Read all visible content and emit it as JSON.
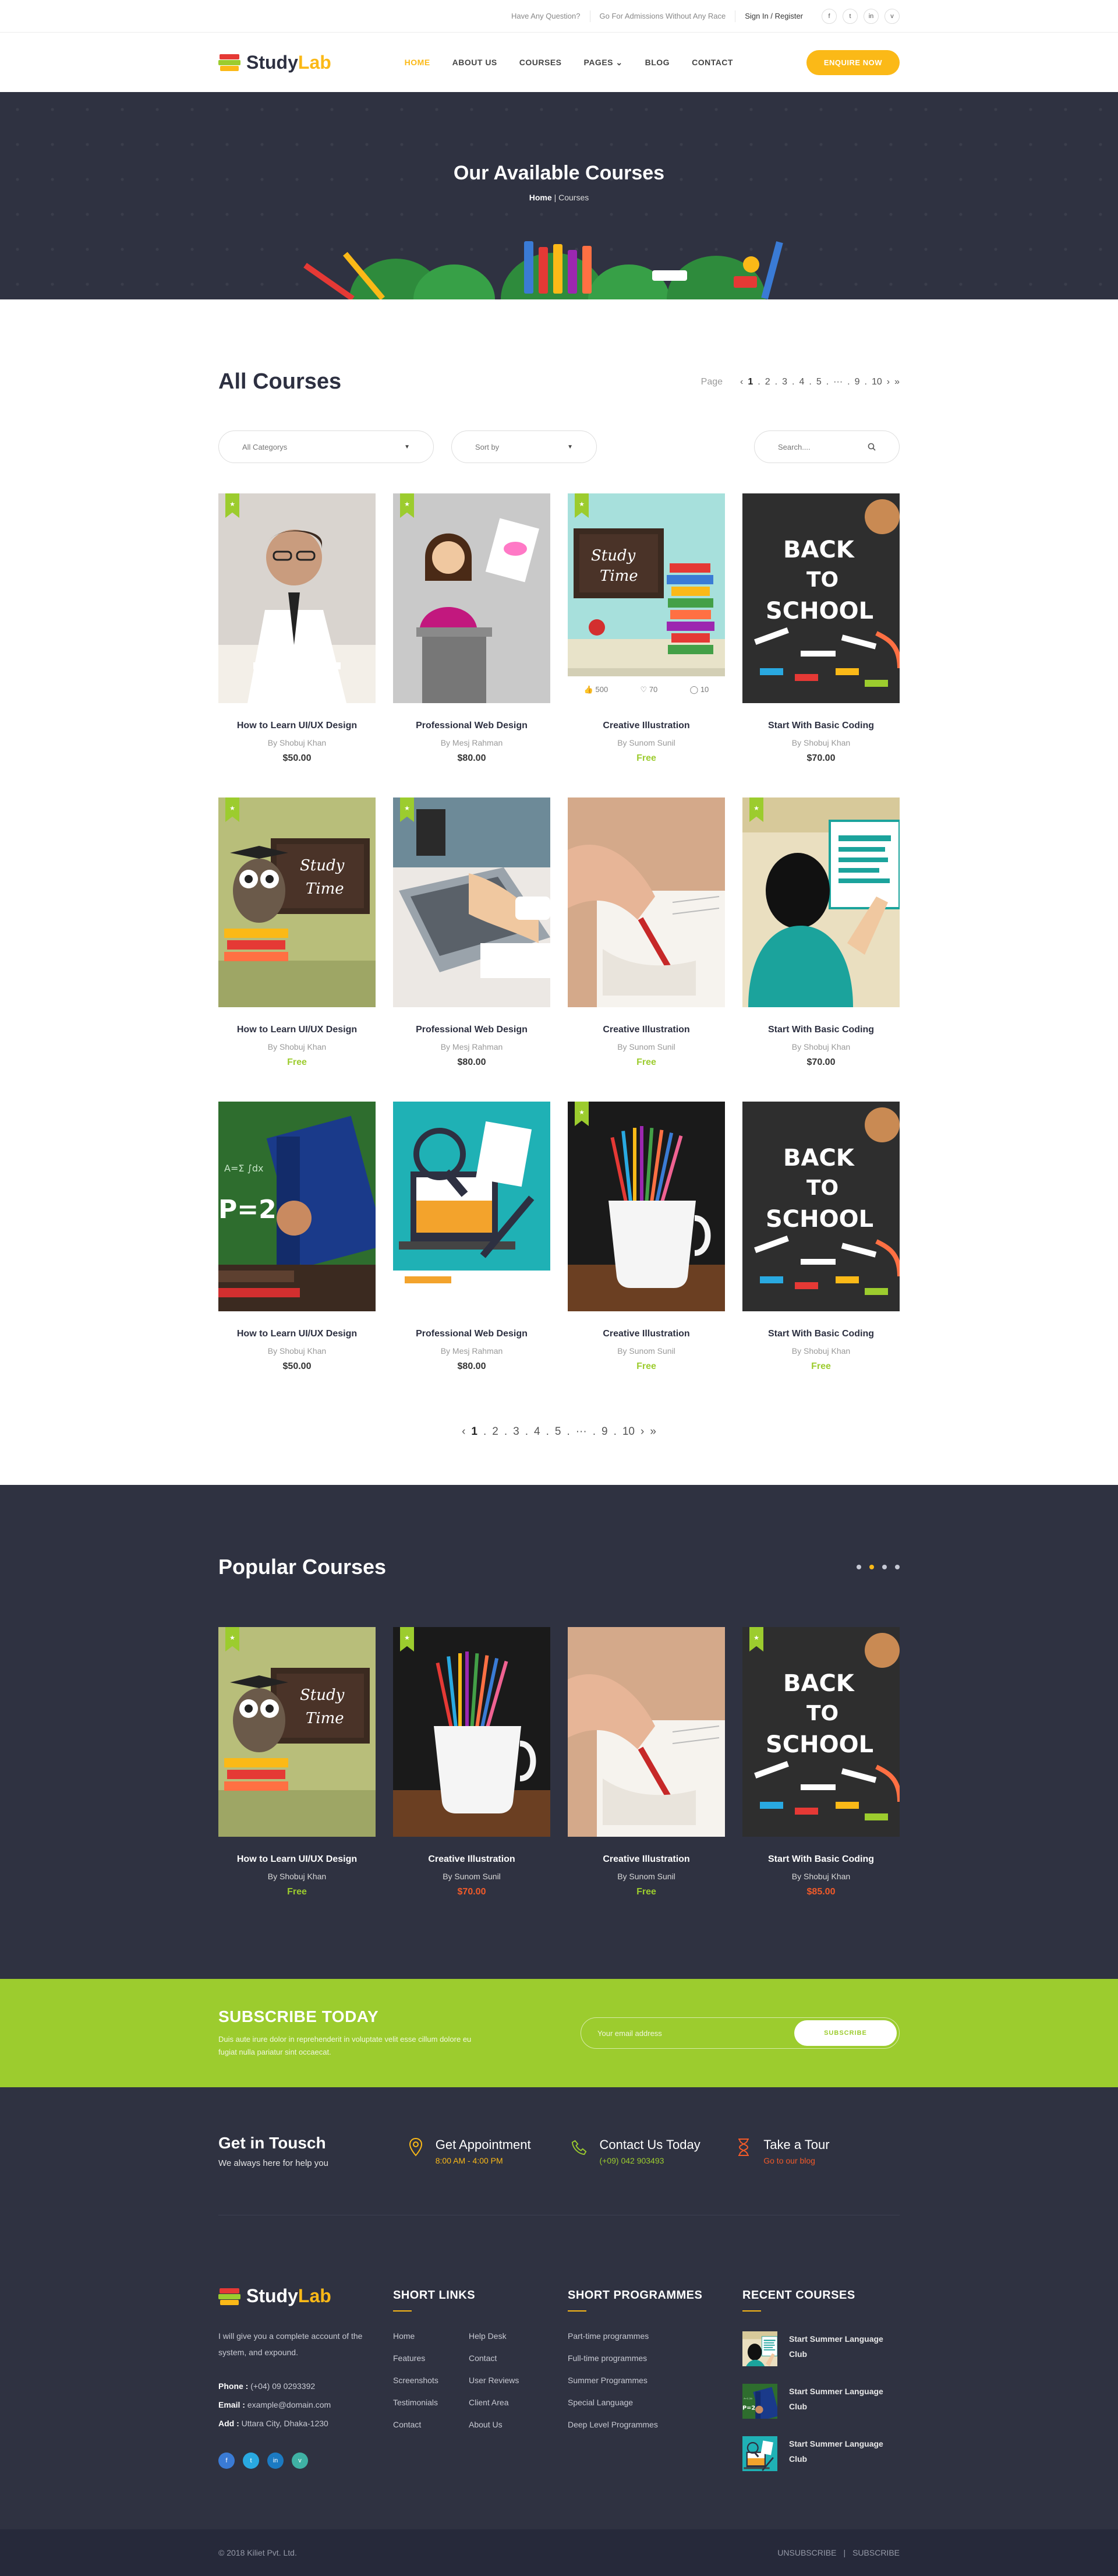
{
  "topbar": {
    "question": "Have Any Question?",
    "admissions": "Go For Admissions Without Any Race",
    "signin": "Sign In / Register",
    "socials": [
      "f",
      "t",
      "in",
      "v"
    ]
  },
  "header": {
    "logo_study": "Study",
    "logo_lab": "Lab",
    "nav": [
      "HOME",
      "ABOUT US",
      "COURSES",
      "PAGES",
      "BLOG",
      "CONTACT"
    ],
    "pages_caret": "⌄",
    "enquire": "ENQUIRE NOW",
    "accent": "#fbb917"
  },
  "hero": {
    "title": "Our Available Courses",
    "crumb_home": "Home",
    "crumb_sep": "|",
    "crumb_current": "Courses"
  },
  "all_courses": {
    "title": "All Courses",
    "page_label": "Page",
    "pager": [
      "‹",
      "1",
      ".",
      "2",
      ".",
      "3",
      ".",
      "4",
      ".",
      "5",
      ".",
      "···",
      ".",
      "9",
      ".",
      "10",
      "›",
      "»"
    ],
    "category_select": "All Categorys",
    "sort_select": "Sort by",
    "search_placeholder": "Search....",
    "courses": [
      {
        "title": "How to Learn UI/UX Design",
        "author": "By Shobuj Khan",
        "price": "$50.00",
        "free": false,
        "ribbon": true
      },
      {
        "title": "Professional Web Design",
        "author": "By Mesj Rahman",
        "price": "$80.00",
        "free": false,
        "ribbon": true
      },
      {
        "title": "Creative Illustration",
        "author": "By Sunom Sunil",
        "price": "Free",
        "free": true,
        "ribbon": true,
        "stats": [
          "500",
          "70",
          "10"
        ]
      },
      {
        "title": "Start With Basic Coding",
        "author": "By Shobuj Khan",
        "price": "$70.00",
        "free": false,
        "ribbon": false
      },
      {
        "title": "How to Learn UI/UX Design",
        "author": "By Shobuj Khan",
        "price": "Free",
        "free": true,
        "ribbon": true
      },
      {
        "title": "Professional Web Design",
        "author": "By Mesj Rahman",
        "price": "$80.00",
        "free": false,
        "ribbon": true
      },
      {
        "title": "Creative Illustration",
        "author": "By Sunom Sunil",
        "price": "Free",
        "free": true,
        "ribbon": false
      },
      {
        "title": "Start With Basic Coding",
        "author": "By Shobuj Khan",
        "price": "$70.00",
        "free": false,
        "ribbon": true
      },
      {
        "title": "How to Learn UI/UX Design",
        "author": "By Shobuj Khan",
        "price": "$50.00",
        "free": false,
        "ribbon": false
      },
      {
        "title": "Professional Web Design",
        "author": "By Mesj Rahman",
        "price": "$80.00",
        "free": false,
        "ribbon": false
      },
      {
        "title": "Creative Illustration",
        "author": "By Sunom Sunil",
        "price": "Free",
        "free": true,
        "ribbon": true
      },
      {
        "title": "Start With Basic Coding",
        "author": "By Shobuj Khan",
        "price": "Free",
        "free": true,
        "ribbon": false
      }
    ],
    "pager_bottom": [
      "‹",
      "1",
      ".",
      "2",
      ".",
      "3",
      ".",
      "4",
      ".",
      "5",
      ".",
      "···",
      ".",
      "9",
      ".",
      "10",
      "›",
      "»"
    ]
  },
  "popular": {
    "title": "Popular Courses",
    "courses": [
      {
        "title": "How to Learn UI/UX Design",
        "author": "By Shobuj Khan",
        "price": "Free",
        "style": "free"
      },
      {
        "title": "Creative Illustration",
        "author": "By Sunom Sunil",
        "price": "$70.00",
        "style": "red"
      },
      {
        "title": "Creative Illustration",
        "author": "By Sunom Sunil",
        "price": "Free",
        "style": "free"
      },
      {
        "title": "Start With Basic Coding",
        "author": "By Shobuj Khan",
        "price": "$85.00",
        "style": "red"
      }
    ]
  },
  "subscribe": {
    "title": "SUBSCRIBE TODAY",
    "text": "Duis aute irure dolor in reprehenderit in voluptate velit esse cillum dolore eu fugiat nulla pariatur sint occaecat.",
    "placeholder": "Your email address",
    "button": "SUBSCRIBE",
    "color": "#9ccc2e"
  },
  "touch": {
    "title": "Get in Tousch",
    "subtitle": "We always here for help you",
    "items": [
      {
        "title": "Get Appointment",
        "sub": "8:00 AM - 4:00 PM",
        "color": "#fbb917"
      },
      {
        "title": "Contact Us Today",
        "sub": "(+09) 042 903493",
        "color": "#9ccc2e"
      },
      {
        "title": "Take a Tour",
        "sub": "Go to our blog",
        "color": "#f15a29"
      }
    ]
  },
  "footer": {
    "about": "I will give you a complete account of the system, and expound.",
    "phone_label": "Phone :",
    "phone": "(+04) 09 0293392",
    "email_label": "Email :",
    "email": "example@domain.com",
    "add_label": "Add :",
    "address": "Uttara City, Dhaka-1230",
    "short_links_title": "SHORT LINKS",
    "short_links": [
      "Home",
      "Help Desk",
      "Features",
      "Contact",
      "Screenshots",
      "User Reviews",
      "Testimonials",
      "Client Area",
      "Contact",
      "About Us"
    ],
    "programmes_title": "SHORT PROGRAMMES",
    "programmes": [
      "Part-time programmes",
      "Full-time programmes",
      "Summer Programmes",
      "Special Language",
      "Deep Level Programmes"
    ],
    "recent_title": "RECENT COURSES",
    "recent": [
      "Start Summer Language Club",
      "Start Summer Language Club",
      "Start Summer Language Club"
    ]
  },
  "copyright": {
    "text": "© 2018 Kiliet Pvt. Ltd.",
    "unsubscribe": "UNSUBSCRIBE",
    "sep": "|",
    "subscribe": "SUBSCRIBE"
  }
}
